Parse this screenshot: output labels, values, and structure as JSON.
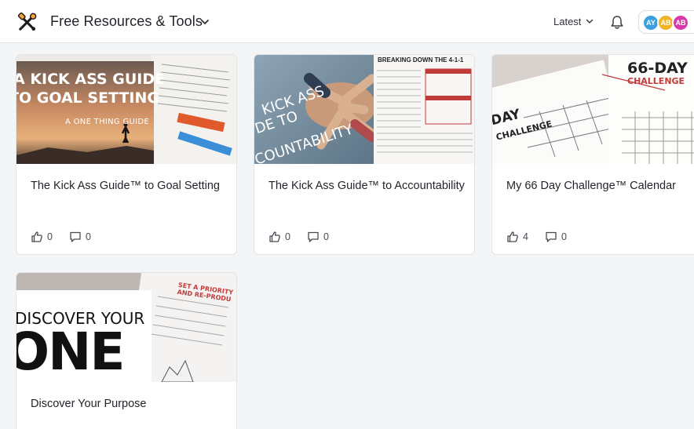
{
  "header": {
    "title": "Free Resources & Tools",
    "sort_label": "Latest",
    "avatars": [
      {
        "initials": "AY",
        "color": "#3aa0e0"
      },
      {
        "initials": "AB",
        "color": "#f0b429"
      },
      {
        "initials": "AB",
        "color": "#d63aa8"
      }
    ]
  },
  "cards": [
    {
      "title": "The Kick Ass Guide™ to Goal Setting",
      "likes": "0",
      "comments": "0",
      "thumb_lines": [
        "A KICK ASS GUIDE",
        "TO GOAL SETTING",
        "A ONE THING GUIDE"
      ]
    },
    {
      "title": "The Kick Ass Guide™ to Accountability",
      "likes": "0",
      "comments": "0",
      "thumb_lines": [
        "KICK ASS",
        "DE TO",
        "COUNTABILITY",
        "BREAKING DOWN THE 4-1-1"
      ]
    },
    {
      "title": "My 66 Day Challenge™ Calendar",
      "likes": "4",
      "comments": "0",
      "thumb_lines": [
        "66-DAY",
        "CHALLENGE",
        "DAY",
        "CHALLENGE"
      ]
    },
    {
      "title": "Discover Your Purpose",
      "likes": "",
      "comments": "",
      "thumb_lines": [
        "DISCOVER YOUR",
        "ONE",
        "SET A PRIORITY AND RE-PRODU"
      ]
    }
  ]
}
